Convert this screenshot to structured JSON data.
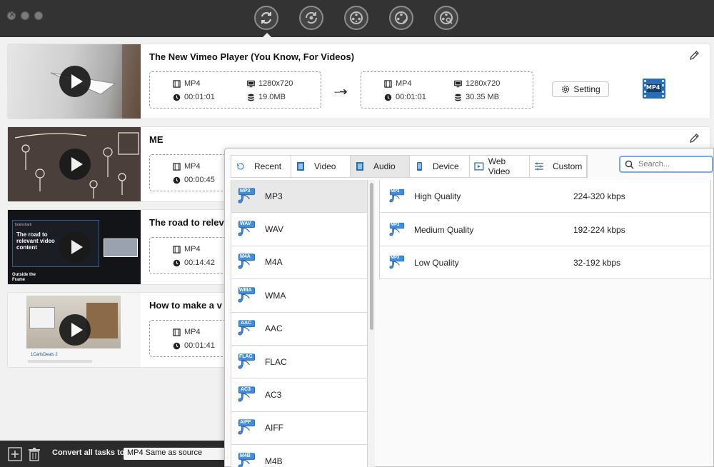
{
  "window": {
    "toolbar_icons": [
      "convert-icon",
      "rotate-convert-icon",
      "film-reel-icon",
      "film-edit-icon",
      "film-search-icon"
    ]
  },
  "tasks": [
    {
      "title": "The New Vimeo Player (You Know, For Videos)",
      "source": {
        "format": "MP4",
        "resolution": "1280x720",
        "duration": "00:01:01",
        "size": "19.0MB"
      },
      "target": {
        "format": "MP4",
        "resolution": "1280x720",
        "duration": "00:01:01",
        "size": "30.35 MB"
      },
      "setting_label": "Setting",
      "output_badge": "MP4"
    },
    {
      "title": "ME",
      "source": {
        "format": "MP4",
        "duration": "00:00:45"
      }
    },
    {
      "title": "The road to relev",
      "source": {
        "format": "MP4",
        "duration": "00:14:42"
      },
      "thumb_text": {
        "caption": "The road to relevant video content",
        "brand": "Outside the Frame",
        "corner": "brainshark"
      }
    },
    {
      "title": "How to make a v",
      "source": {
        "format": "MP4",
        "duration": "00:01:41"
      },
      "thumb_text": {
        "caption": "1CarlsDeals 2"
      }
    }
  ],
  "bottom": {
    "convert_label": "Convert all tasks to",
    "convert_value": "MP4 Same as source"
  },
  "popup": {
    "tabs": [
      {
        "label": "Recent",
        "icon": "recent-icon"
      },
      {
        "label": "Video",
        "icon": "video-icon"
      },
      {
        "label": "Audio",
        "icon": "audio-icon",
        "active": true
      },
      {
        "label": "Device",
        "icon": "device-icon"
      },
      {
        "label": "Web Video",
        "icon": "web-video-icon"
      },
      {
        "label": "Custom",
        "icon": "custom-icon"
      }
    ],
    "search_placeholder": "Search...",
    "formats": [
      {
        "badge": "MP3",
        "label": "MP3"
      },
      {
        "badge": "WAV",
        "label": "WAV"
      },
      {
        "badge": "M4A",
        "label": "M4A"
      },
      {
        "badge": "WMA",
        "label": "WMA"
      },
      {
        "badge": "AAC",
        "label": "AAC"
      },
      {
        "badge": "FLAC",
        "label": "FLAC"
      },
      {
        "badge": "AC3",
        "label": "AC3"
      },
      {
        "badge": "AIFF",
        "label": "AIFF"
      },
      {
        "badge": "M4B",
        "label": "M4B"
      }
    ],
    "qualities": [
      {
        "badge": "MP3",
        "label": "High Quality",
        "bitrate": "224-320 kbps"
      },
      {
        "badge": "MP3",
        "label": "Medium Quality",
        "bitrate": "192-224 kbps"
      },
      {
        "badge": "MP3",
        "label": "Low Quality",
        "bitrate": "32-192 kbps"
      }
    ]
  },
  "colors": {
    "titlebar": "#333333",
    "badge_blue": "#2d7fd0",
    "search_focus": "#7da7e6"
  }
}
